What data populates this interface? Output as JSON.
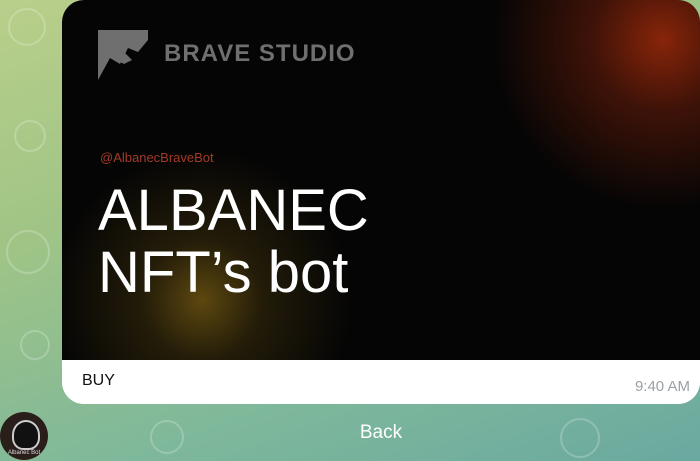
{
  "banner": {
    "brand": "BRAVE STUDIO",
    "handle": "@AlbanecBraveBot",
    "headline_line1": "ALBANEC",
    "headline_line2": "NFT’s bot"
  },
  "message": {
    "button_label": "BUY",
    "time": "9:40 AM"
  },
  "footer": {
    "back_label": "Back"
  },
  "avatar": {
    "caption": "Albanec Bot"
  },
  "colors": {
    "accent_handle": "#a33a2a",
    "banner_bg": "#050505",
    "chat_bg": "#9fc486"
  }
}
